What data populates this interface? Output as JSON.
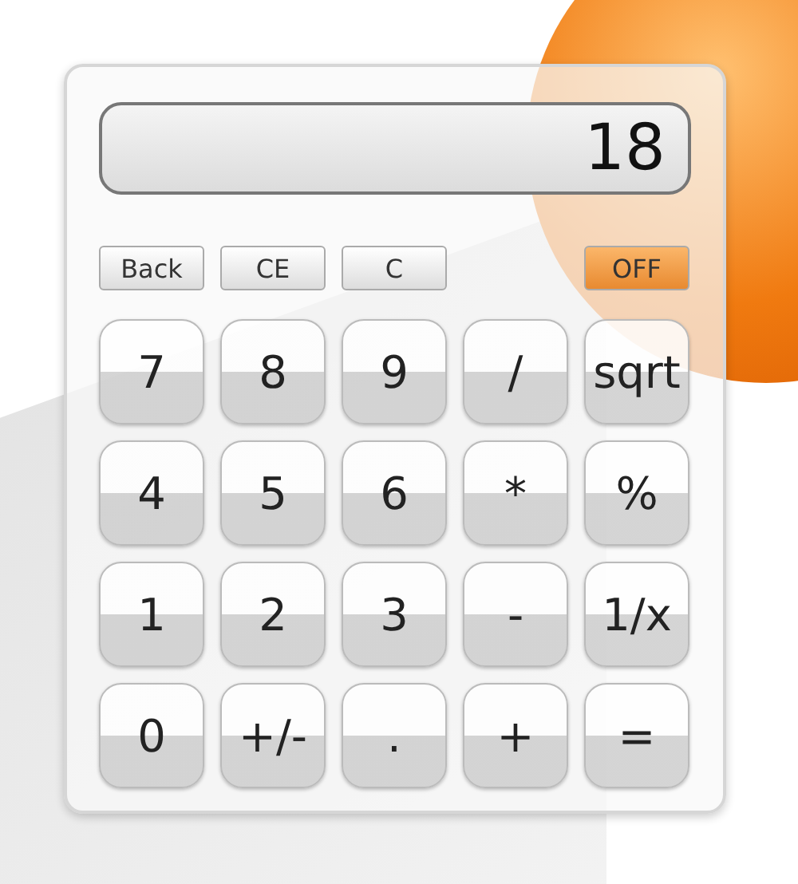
{
  "display": {
    "value": "18"
  },
  "function_buttons": [
    {
      "label": "Back",
      "kind": "edit"
    },
    {
      "label": "CE",
      "kind": "edit"
    },
    {
      "label": "C",
      "kind": "edit"
    },
    {
      "label": "OFF",
      "kind": "power"
    }
  ],
  "keys": [
    {
      "label": "7"
    },
    {
      "label": "8"
    },
    {
      "label": "9"
    },
    {
      "label": "/"
    },
    {
      "label": "sqrt"
    },
    {
      "label": "4"
    },
    {
      "label": "5"
    },
    {
      "label": "6"
    },
    {
      "label": "*"
    },
    {
      "label": "%"
    },
    {
      "label": "1"
    },
    {
      "label": "2"
    },
    {
      "label": "3"
    },
    {
      "label": "-"
    },
    {
      "label": "1/x"
    },
    {
      "label": "0"
    },
    {
      "label": "+/-"
    },
    {
      "label": "."
    },
    {
      "label": "+"
    },
    {
      "label": "="
    }
  ]
}
